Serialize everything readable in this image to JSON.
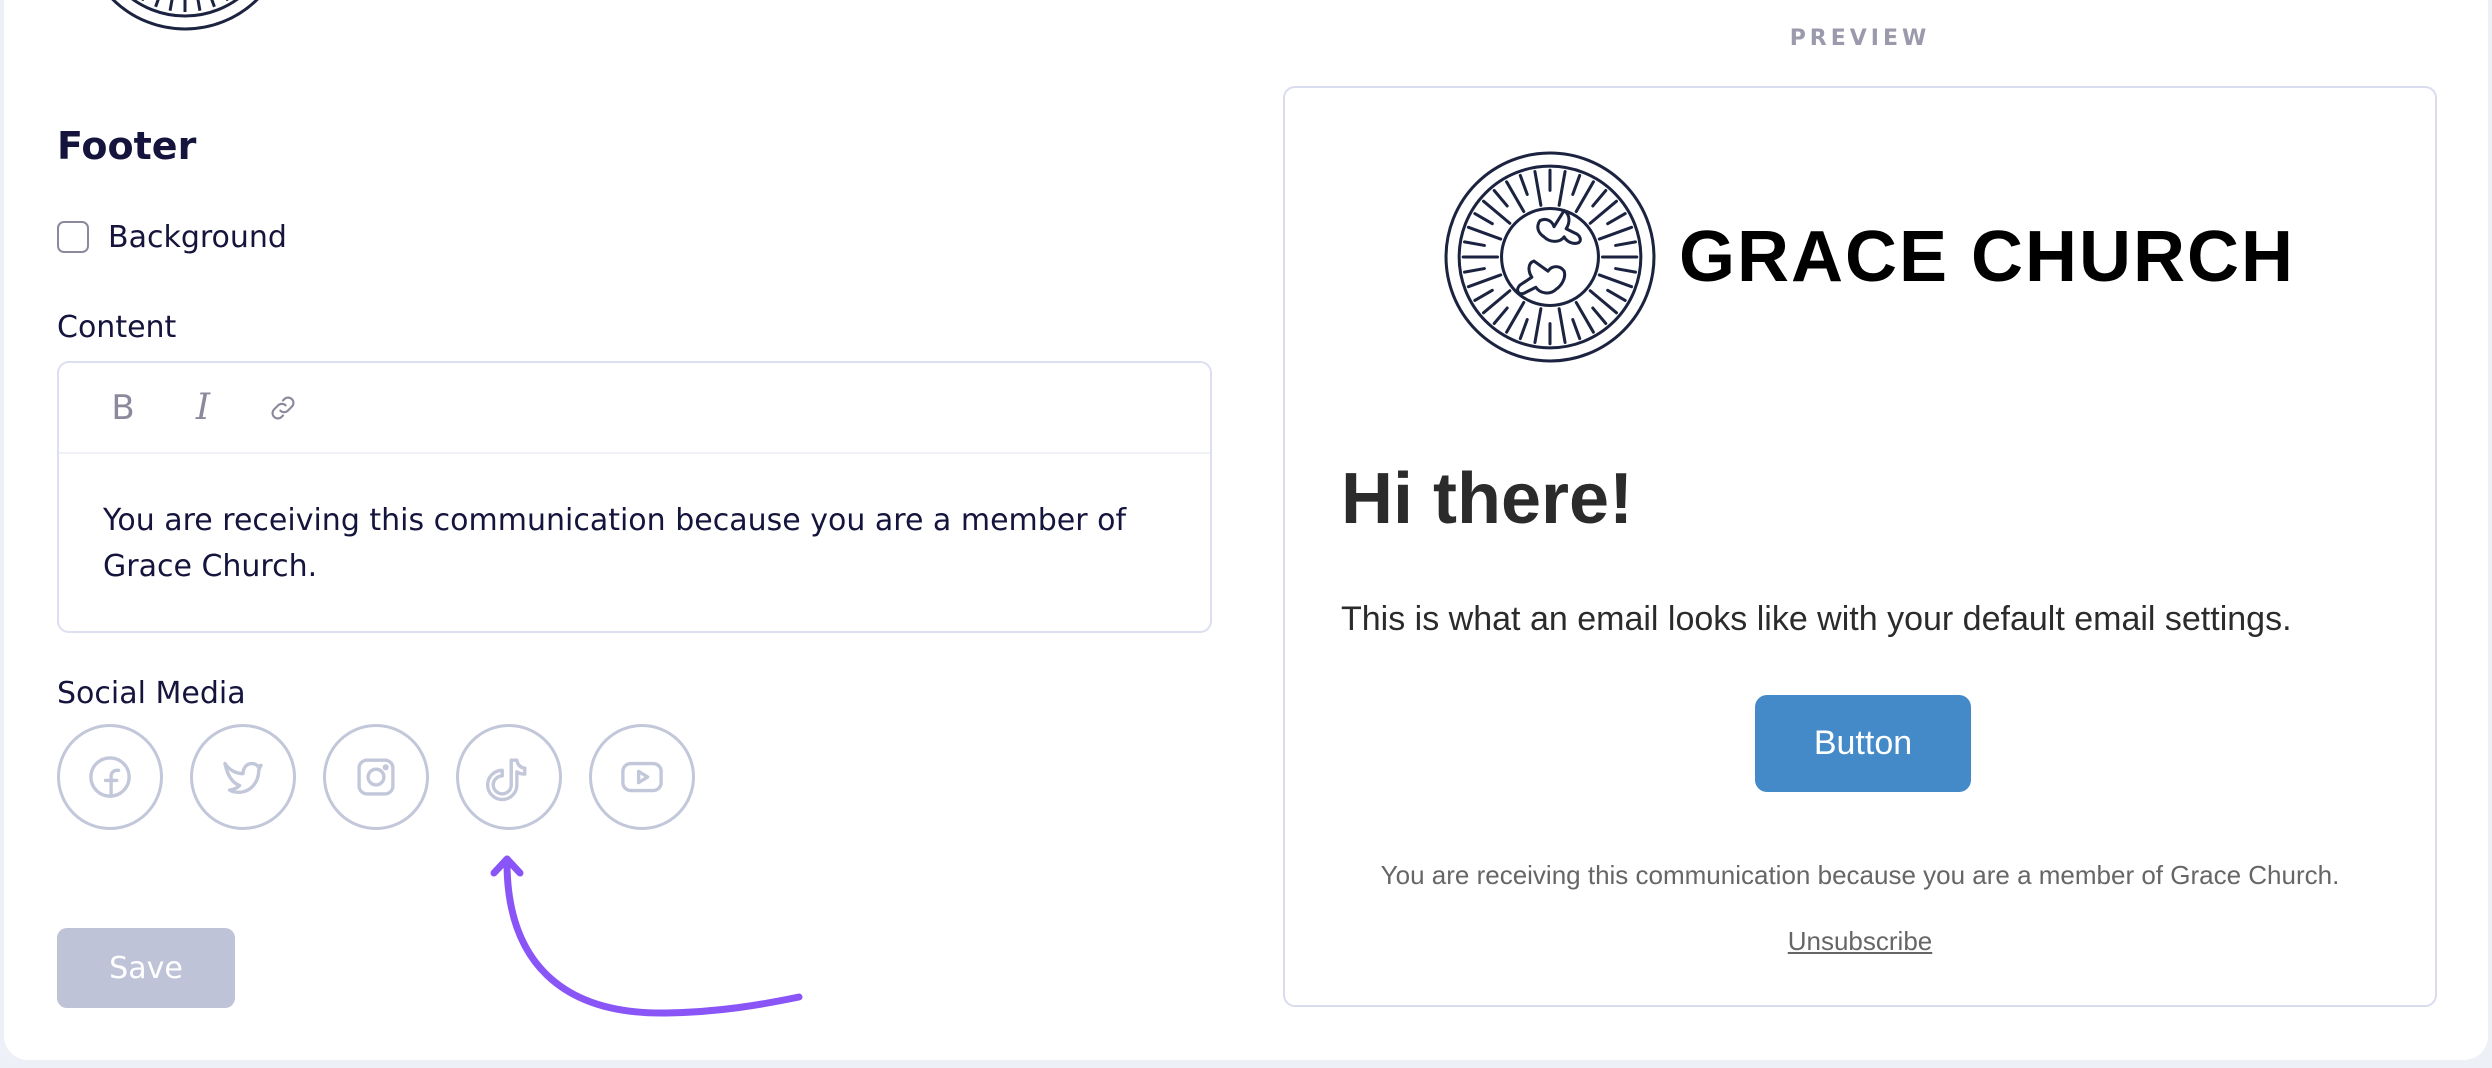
{
  "settings": {
    "section_title": "Footer",
    "background_checkbox": {
      "label": "Background",
      "checked": false
    },
    "content": {
      "label": "Content",
      "toolbar": {
        "bold": "B",
        "italic": "I",
        "link": "link-icon"
      },
      "value": "You are receiving this communication because you are a member of Grace Church."
    },
    "social_media": {
      "label": "Social Media",
      "items": [
        {
          "name": "Facebook",
          "icon": "facebook-icon"
        },
        {
          "name": "Twitter",
          "icon": "twitter-icon"
        },
        {
          "name": "Instagram",
          "icon": "instagram-icon"
        },
        {
          "name": "TikTok",
          "icon": "tiktok-icon"
        },
        {
          "name": "YouTube",
          "icon": "youtube-icon"
        }
      ]
    },
    "save_label": "Save"
  },
  "preview": {
    "label": "PREVIEW",
    "brand_name": "GRACE CHURCH",
    "greeting": "Hi there!",
    "body": "This is what an email looks like with your default email settings.",
    "button_label": "Button",
    "footer_note": "You are receiving this communication because you are a member of Grace Church.",
    "unsubscribe_label": "Unsubscribe"
  },
  "colors": {
    "accent_arrow": "#8a55f7",
    "preview_button": "#448ac8",
    "save_disabled": "#bec3d7",
    "social_icon": "#c2c7da",
    "logo_ink": "#1b2340"
  }
}
